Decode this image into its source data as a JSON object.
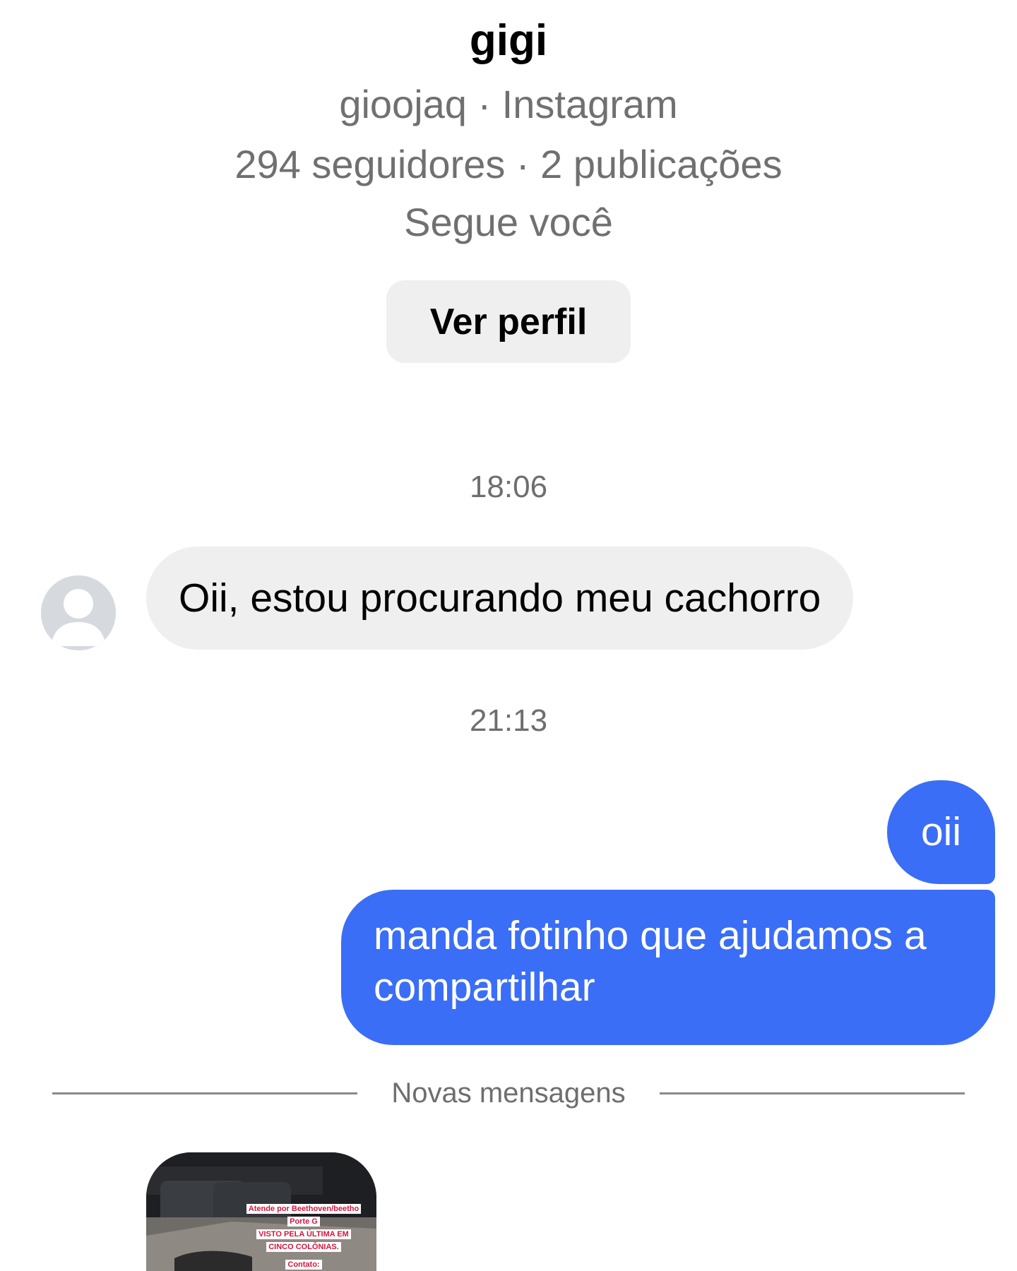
{
  "profile": {
    "name": "gigi",
    "handle_line": "gioojaq · Instagram",
    "stats_line": "294 seguidores · 2 publicações",
    "follow_status": "Segue você",
    "view_profile_label": "Ver perfil"
  },
  "conversation": {
    "timestamps": [
      "18:06",
      "21:13"
    ],
    "messages": [
      {
        "direction": "received",
        "text": "Oii, estou procurando meu cachorro"
      },
      {
        "direction": "sent",
        "text": "oii"
      },
      {
        "direction": "sent",
        "text": "manda fotinho que ajudamos a compartilhar"
      }
    ],
    "new_messages_label": "Novas mensagens"
  },
  "shared_story": {
    "lines": [
      "Atende por Beethoven/beetho",
      "Porte G",
      "VISTO PELA ÚLTIMA EM",
      "CINCO COLÔNIAS.",
      "Contato:"
    ]
  },
  "colors": {
    "sent_bubble": "#3b6ef6",
    "received_bubble": "#efefef",
    "secondary_text": "#707070",
    "story_text": "#d4163c"
  },
  "icons": {
    "avatar": "default-user-avatar-icon"
  }
}
